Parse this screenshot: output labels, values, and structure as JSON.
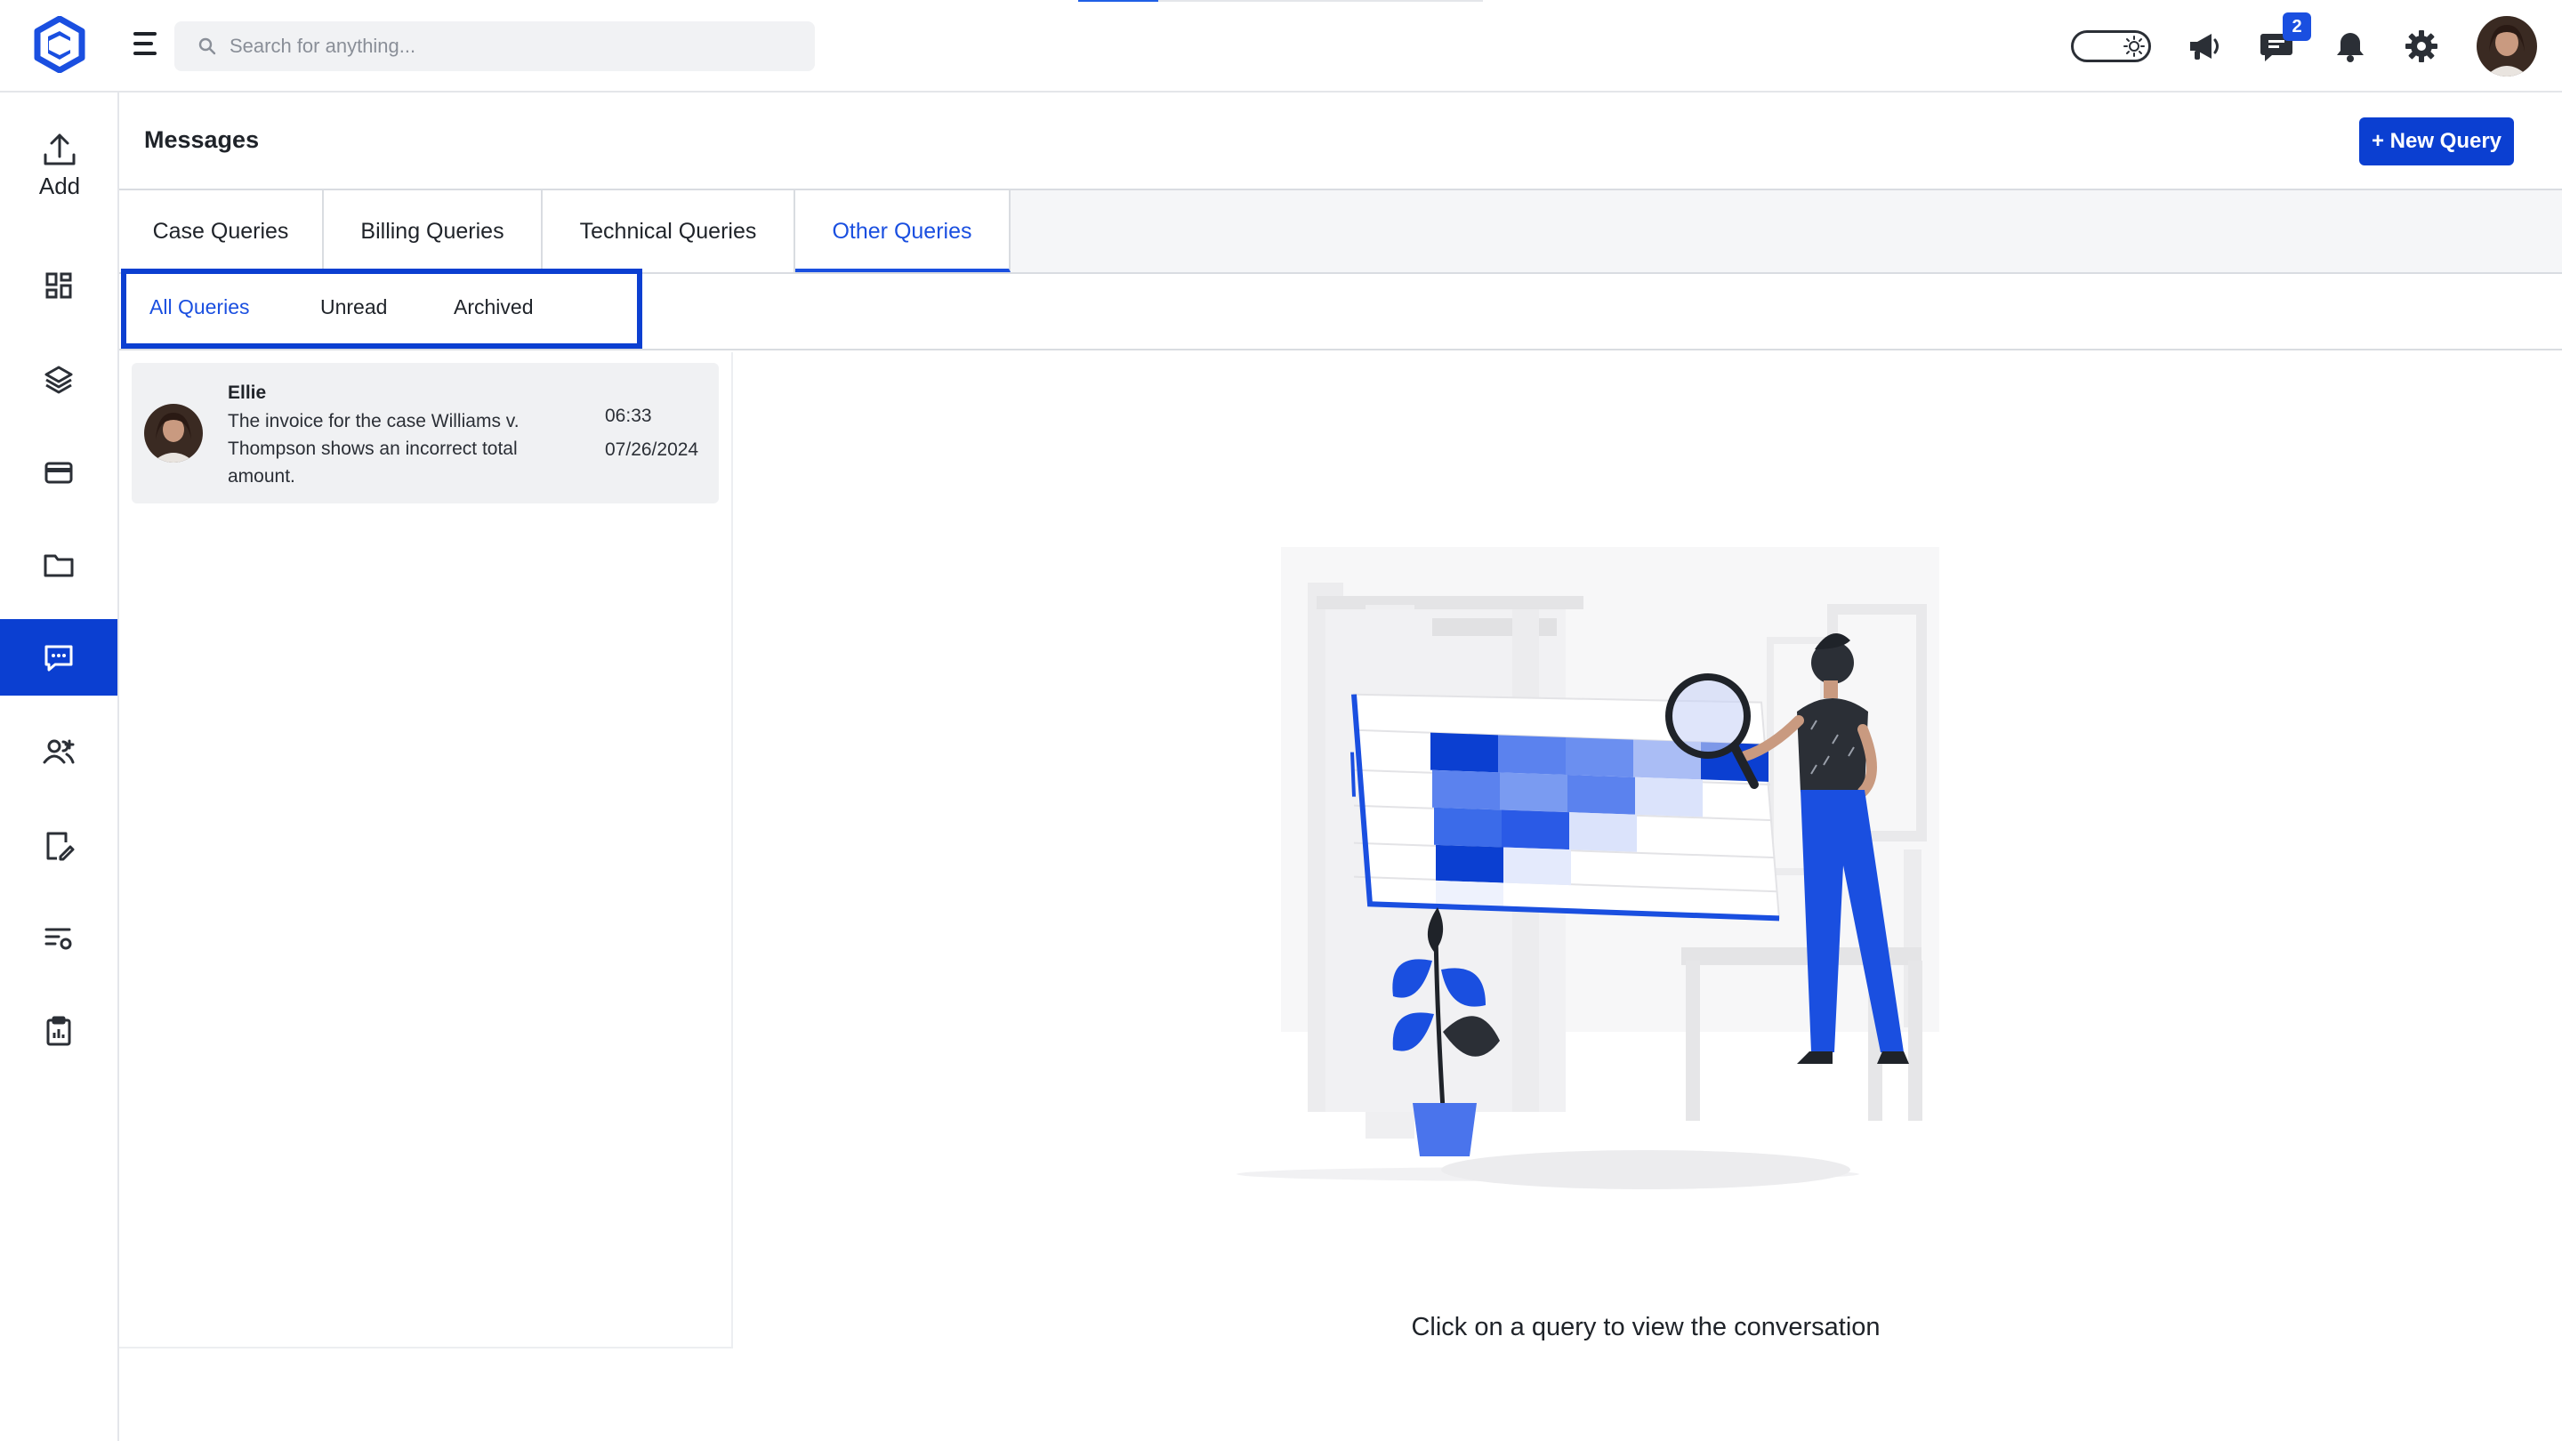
{
  "topbar": {
    "search_placeholder": "Search for anything...",
    "chat_badge": "2"
  },
  "sidebar": {
    "add_label": "Add",
    "items": [
      "dashboard",
      "layers",
      "billing",
      "folder",
      "messages",
      "users",
      "edit-document",
      "settings-list",
      "clipboard"
    ],
    "active_item": "messages"
  },
  "main": {
    "title": "Messages",
    "new_query_label": "+ New Query",
    "tabs": [
      {
        "label": "Case Queries"
      },
      {
        "label": "Billing Queries"
      },
      {
        "label": "Technical Queries"
      },
      {
        "label": "Other Queries"
      }
    ],
    "active_tab": "Other Queries",
    "subtabs": [
      {
        "label": "All Queries"
      },
      {
        "label": "Unread"
      },
      {
        "label": "Archived"
      }
    ],
    "active_subtab": "All Queries",
    "messages": [
      {
        "name": "Ellie",
        "text": "The invoice for the case Williams v. Thompson shows an incorrect total amount.",
        "time": "06:33",
        "date": "07/26/2024"
      }
    ],
    "empty_state": "Click on a query to view the conversation"
  },
  "colors": {
    "accent": "#1a4fe0",
    "accent_dark": "#0b3fd1",
    "border": "#d9dce1"
  }
}
